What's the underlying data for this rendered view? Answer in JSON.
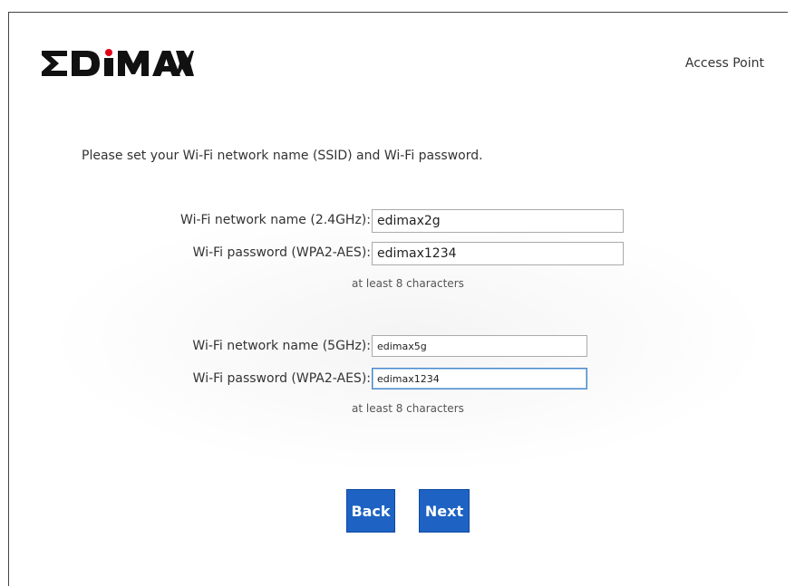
{
  "brand": {
    "logo_text": "EDIMAX",
    "mode": "Access Point"
  },
  "wizard": {
    "intro": "Please set your Wi-Fi network name (SSID) and Wi-Fi password.",
    "band24": {
      "ssid_label": "Wi-Fi network name (2.4GHz):",
      "ssid_value": "edimax2g",
      "pw_label": "Wi-Fi password (WPA2-AES):",
      "pw_value": "edimax1234",
      "hint": "at least 8 characters"
    },
    "band5": {
      "ssid_label": "Wi-Fi network name (5GHz):",
      "ssid_value": "edimax5g",
      "pw_label": "Wi-Fi password (WPA2-AES):",
      "pw_value": "edimax1234",
      "hint": "at least 8 characters"
    },
    "buttons": {
      "back": "Back",
      "next": "Next"
    }
  },
  "colors": {
    "button": "#1e63c3",
    "logo": "#111111",
    "logo_dot": "#e2001a"
  }
}
